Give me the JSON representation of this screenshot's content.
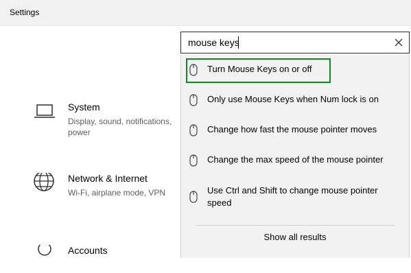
{
  "window": {
    "title": "Settings"
  },
  "categories": [
    {
      "name": "System",
      "description": "Display, sound, notifications, power",
      "icon": "laptop-icon"
    },
    {
      "name": "Network & Internet",
      "description": "Wi-Fi, airplane mode, VPN",
      "icon": "globe-icon"
    },
    {
      "name": "Accounts",
      "description": "",
      "icon": "person-icon"
    }
  ],
  "search": {
    "value": "mouse keys",
    "clear_icon": "close-icon"
  },
  "suggestions": [
    {
      "label": "Turn Mouse Keys on or off",
      "icon": "mouse-icon",
      "highlighted": true
    },
    {
      "label": "Only use Mouse Keys when Num lock is on",
      "icon": "mouse-icon"
    },
    {
      "label": "Change how fast the mouse pointer moves",
      "icon": "mouse-icon"
    },
    {
      "label": "Change the max speed of the mouse pointer",
      "icon": "mouse-icon"
    },
    {
      "label": "Use Ctrl and Shift to change mouse pointer speed",
      "icon": "mouse-icon"
    }
  ],
  "show_all_label": "Show all results",
  "colors": {
    "highlight_border": "#0f8a17",
    "dropdown_bg": "#f2f2f2"
  }
}
